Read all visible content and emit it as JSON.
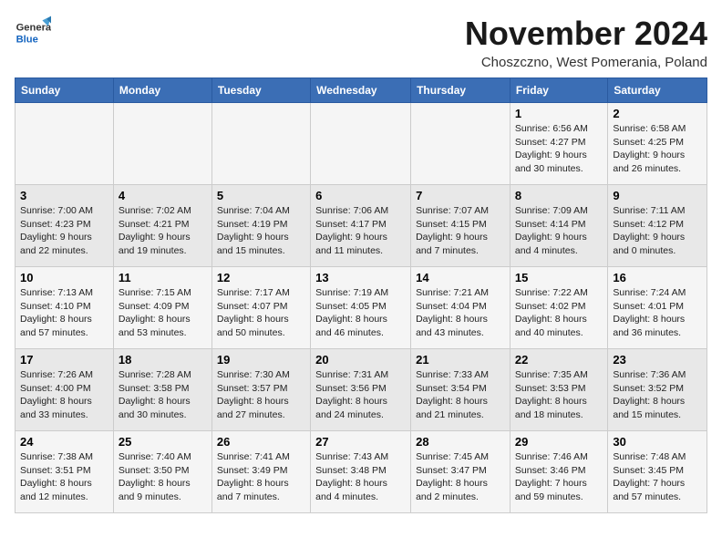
{
  "header": {
    "logo_general": "General",
    "logo_blue": "Blue",
    "month_title": "November 2024",
    "subtitle": "Choszczno, West Pomerania, Poland"
  },
  "calendar": {
    "columns": [
      "Sunday",
      "Monday",
      "Tuesday",
      "Wednesday",
      "Thursday",
      "Friday",
      "Saturday"
    ],
    "weeks": [
      [
        {
          "day": "",
          "info": ""
        },
        {
          "day": "",
          "info": ""
        },
        {
          "day": "",
          "info": ""
        },
        {
          "day": "",
          "info": ""
        },
        {
          "day": "",
          "info": ""
        },
        {
          "day": "1",
          "info": "Sunrise: 6:56 AM\nSunset: 4:27 PM\nDaylight: 9 hours and 30 minutes."
        },
        {
          "day": "2",
          "info": "Sunrise: 6:58 AM\nSunset: 4:25 PM\nDaylight: 9 hours and 26 minutes."
        }
      ],
      [
        {
          "day": "3",
          "info": "Sunrise: 7:00 AM\nSunset: 4:23 PM\nDaylight: 9 hours and 22 minutes."
        },
        {
          "day": "4",
          "info": "Sunrise: 7:02 AM\nSunset: 4:21 PM\nDaylight: 9 hours and 19 minutes."
        },
        {
          "day": "5",
          "info": "Sunrise: 7:04 AM\nSunset: 4:19 PM\nDaylight: 9 hours and 15 minutes."
        },
        {
          "day": "6",
          "info": "Sunrise: 7:06 AM\nSunset: 4:17 PM\nDaylight: 9 hours and 11 minutes."
        },
        {
          "day": "7",
          "info": "Sunrise: 7:07 AM\nSunset: 4:15 PM\nDaylight: 9 hours and 7 minutes."
        },
        {
          "day": "8",
          "info": "Sunrise: 7:09 AM\nSunset: 4:14 PM\nDaylight: 9 hours and 4 minutes."
        },
        {
          "day": "9",
          "info": "Sunrise: 7:11 AM\nSunset: 4:12 PM\nDaylight: 9 hours and 0 minutes."
        }
      ],
      [
        {
          "day": "10",
          "info": "Sunrise: 7:13 AM\nSunset: 4:10 PM\nDaylight: 8 hours and 57 minutes."
        },
        {
          "day": "11",
          "info": "Sunrise: 7:15 AM\nSunset: 4:09 PM\nDaylight: 8 hours and 53 minutes."
        },
        {
          "day": "12",
          "info": "Sunrise: 7:17 AM\nSunset: 4:07 PM\nDaylight: 8 hours and 50 minutes."
        },
        {
          "day": "13",
          "info": "Sunrise: 7:19 AM\nSunset: 4:05 PM\nDaylight: 8 hours and 46 minutes."
        },
        {
          "day": "14",
          "info": "Sunrise: 7:21 AM\nSunset: 4:04 PM\nDaylight: 8 hours and 43 minutes."
        },
        {
          "day": "15",
          "info": "Sunrise: 7:22 AM\nSunset: 4:02 PM\nDaylight: 8 hours and 40 minutes."
        },
        {
          "day": "16",
          "info": "Sunrise: 7:24 AM\nSunset: 4:01 PM\nDaylight: 8 hours and 36 minutes."
        }
      ],
      [
        {
          "day": "17",
          "info": "Sunrise: 7:26 AM\nSunset: 4:00 PM\nDaylight: 8 hours and 33 minutes."
        },
        {
          "day": "18",
          "info": "Sunrise: 7:28 AM\nSunset: 3:58 PM\nDaylight: 8 hours and 30 minutes."
        },
        {
          "day": "19",
          "info": "Sunrise: 7:30 AM\nSunset: 3:57 PM\nDaylight: 8 hours and 27 minutes."
        },
        {
          "day": "20",
          "info": "Sunrise: 7:31 AM\nSunset: 3:56 PM\nDaylight: 8 hours and 24 minutes."
        },
        {
          "day": "21",
          "info": "Sunrise: 7:33 AM\nSunset: 3:54 PM\nDaylight: 8 hours and 21 minutes."
        },
        {
          "day": "22",
          "info": "Sunrise: 7:35 AM\nSunset: 3:53 PM\nDaylight: 8 hours and 18 minutes."
        },
        {
          "day": "23",
          "info": "Sunrise: 7:36 AM\nSunset: 3:52 PM\nDaylight: 8 hours and 15 minutes."
        }
      ],
      [
        {
          "day": "24",
          "info": "Sunrise: 7:38 AM\nSunset: 3:51 PM\nDaylight: 8 hours and 12 minutes."
        },
        {
          "day": "25",
          "info": "Sunrise: 7:40 AM\nSunset: 3:50 PM\nDaylight: 8 hours and 9 minutes."
        },
        {
          "day": "26",
          "info": "Sunrise: 7:41 AM\nSunset: 3:49 PM\nDaylight: 8 hours and 7 minutes."
        },
        {
          "day": "27",
          "info": "Sunrise: 7:43 AM\nSunset: 3:48 PM\nDaylight: 8 hours and 4 minutes."
        },
        {
          "day": "28",
          "info": "Sunrise: 7:45 AM\nSunset: 3:47 PM\nDaylight: 8 hours and 2 minutes."
        },
        {
          "day": "29",
          "info": "Sunrise: 7:46 AM\nSunset: 3:46 PM\nDaylight: 7 hours and 59 minutes."
        },
        {
          "day": "30",
          "info": "Sunrise: 7:48 AM\nSunset: 3:45 PM\nDaylight: 7 hours and 57 minutes."
        }
      ]
    ]
  }
}
